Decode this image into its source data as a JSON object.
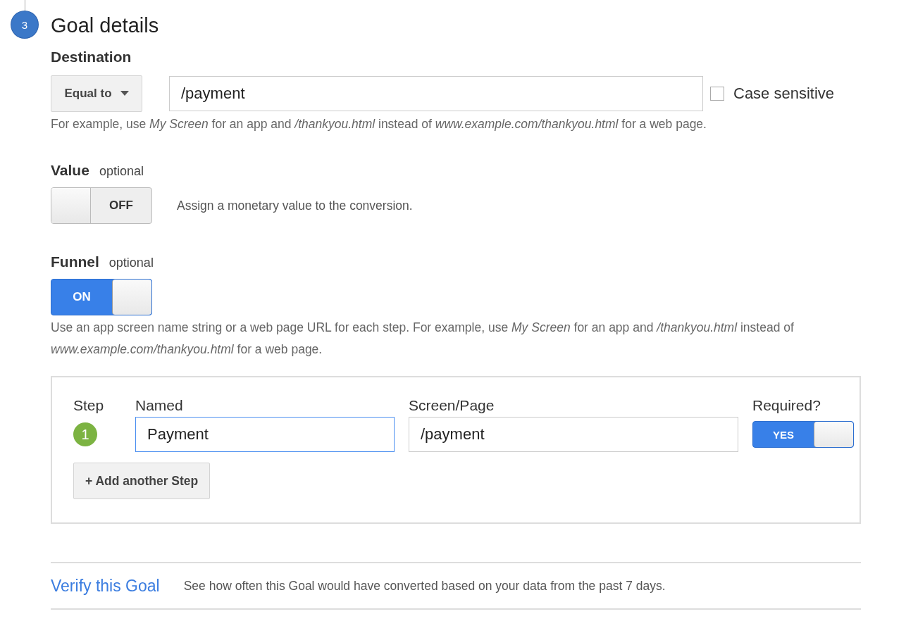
{
  "section": {
    "number": "3",
    "title": "Goal details"
  },
  "destination": {
    "label": "Destination",
    "match": "Equal to",
    "value": "/payment",
    "case_sensitive": {
      "label": "Case sensitive",
      "checked": false
    },
    "hint": "For example, use *My Screen* for an app and */thankyou.html* instead of *www.example.com/thankyou.html* for a web page."
  },
  "value": {
    "label": "Value",
    "optional": "optional",
    "toggle": {
      "on": false,
      "text": "OFF"
    },
    "description": "Assign a monetary value to the conversion."
  },
  "funnel": {
    "label": "Funnel",
    "optional": "optional",
    "toggle": {
      "on": true,
      "text": "ON"
    },
    "hint": "Use an app screen name string or a web page URL for each step. For example, use *My Screen* for an app and */thankyou.html* instead of *www.example.com/thankyou.html* for a web page.",
    "columns": [
      "Step",
      "Named",
      "Screen/Page",
      "Required?"
    ],
    "steps": [
      {
        "number": "1",
        "name": "Payment",
        "focused": true,
        "screen": "/payment",
        "required": {
          "on": true,
          "text": "YES"
        }
      }
    ],
    "add_button": "+ Add another Step"
  },
  "verify": {
    "link": "Verify this Goal",
    "description": "See how often this Goal would have converted based on your data from the past 7 days."
  }
}
